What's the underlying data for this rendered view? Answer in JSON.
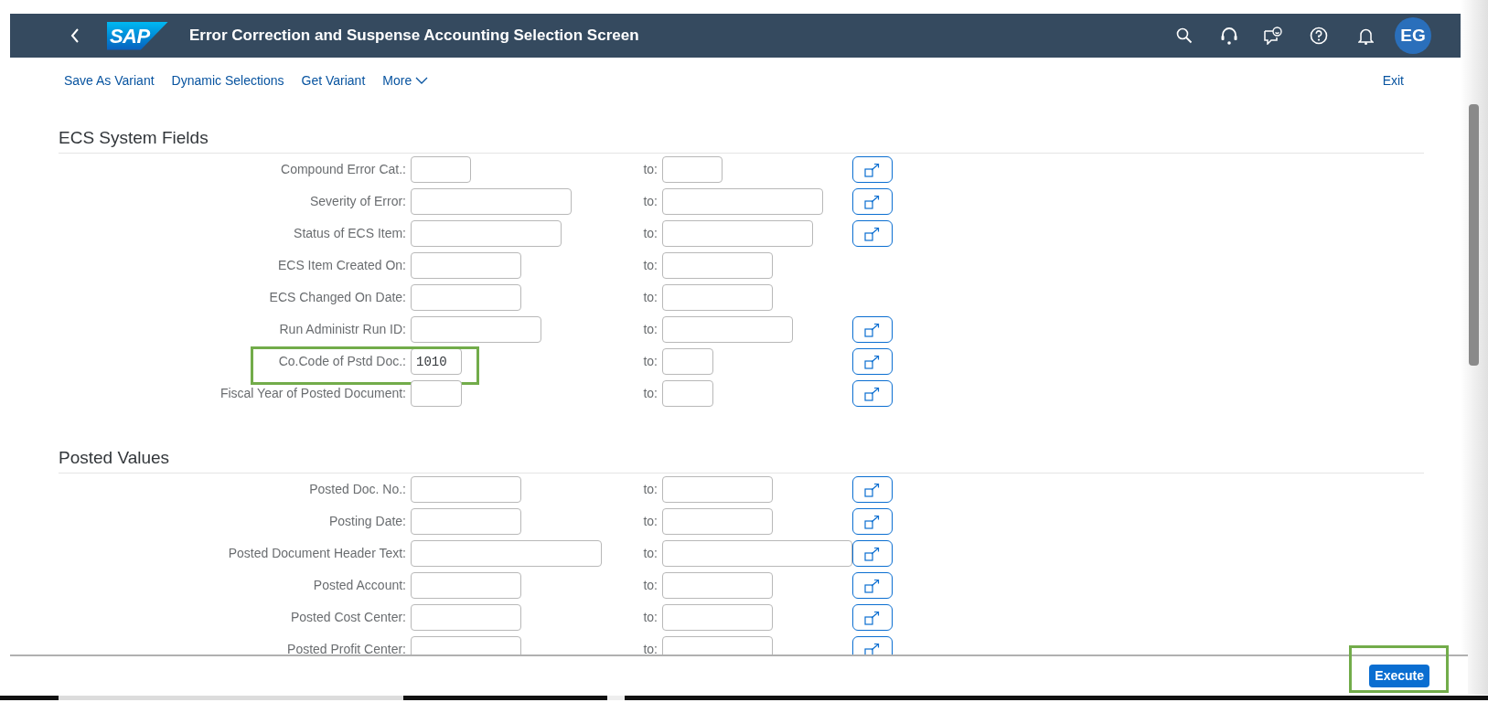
{
  "header": {
    "logo": "SAP",
    "title": "Error Correction and Suspense Accounting Selection Screen",
    "avatar": "EG"
  },
  "toolbar": {
    "actions": [
      {
        "label": "Save As Variant",
        "kind": "link"
      },
      {
        "label": "Dynamic Selections",
        "kind": "link"
      },
      {
        "label": "Get Variant",
        "kind": "link"
      },
      {
        "label": "More",
        "kind": "menu"
      }
    ],
    "exit": "Exit"
  },
  "sections": [
    {
      "title": "ECS System Fields",
      "fields": [
        {
          "label": "Compound Error Cat.:",
          "to_label": "to:",
          "multiple_selection": true,
          "highlighted": false
        },
        {
          "label": "Severity of Error:",
          "to_label": "to:",
          "multiple_selection": true,
          "highlighted": false
        },
        {
          "label": "Status of ECS Item:",
          "to_label": "to:",
          "multiple_selection": true,
          "highlighted": false
        },
        {
          "label": "ECS Item Created On:",
          "to_label": "to:",
          "multiple_selection": false,
          "highlighted": false
        },
        {
          "label": "ECS Changed On Date:",
          "to_label": "to:",
          "multiple_selection": false,
          "highlighted": false
        },
        {
          "label": "Run Administr Run ID:",
          "to_label": "to:",
          "multiple_selection": true,
          "highlighted": false
        },
        {
          "label": "Co.Code of Pstd Doc.:",
          "value": "1010",
          "to_label": "to:",
          "multiple_selection": true,
          "highlighted": true
        },
        {
          "label": "Fiscal Year of Posted Document:",
          "to_label": "to:",
          "multiple_selection": true,
          "highlighted": false
        }
      ]
    },
    {
      "title": "Posted Values",
      "fields": [
        {
          "label": "Posted Doc. No.:",
          "to_label": "to:",
          "multiple_selection": true,
          "highlighted": false
        },
        {
          "label": "Posting Date:",
          "to_label": "to:",
          "multiple_selection": true,
          "highlighted": false
        },
        {
          "label": "Posted Document Header Text:",
          "to_label": "to:",
          "multiple_selection": true,
          "highlighted": false
        },
        {
          "label": "Posted Account:",
          "to_label": "to:",
          "multiple_selection": true,
          "highlighted": false
        },
        {
          "label": "Posted Cost Center:",
          "to_label": "to:",
          "multiple_selection": true,
          "highlighted": false
        },
        {
          "label": "Posted Profit Center:",
          "to_label": "to:",
          "multiple_selection": true,
          "highlighted": false
        }
      ]
    }
  ],
  "footer": {
    "execute": "Execute",
    "highlighted": true
  }
}
